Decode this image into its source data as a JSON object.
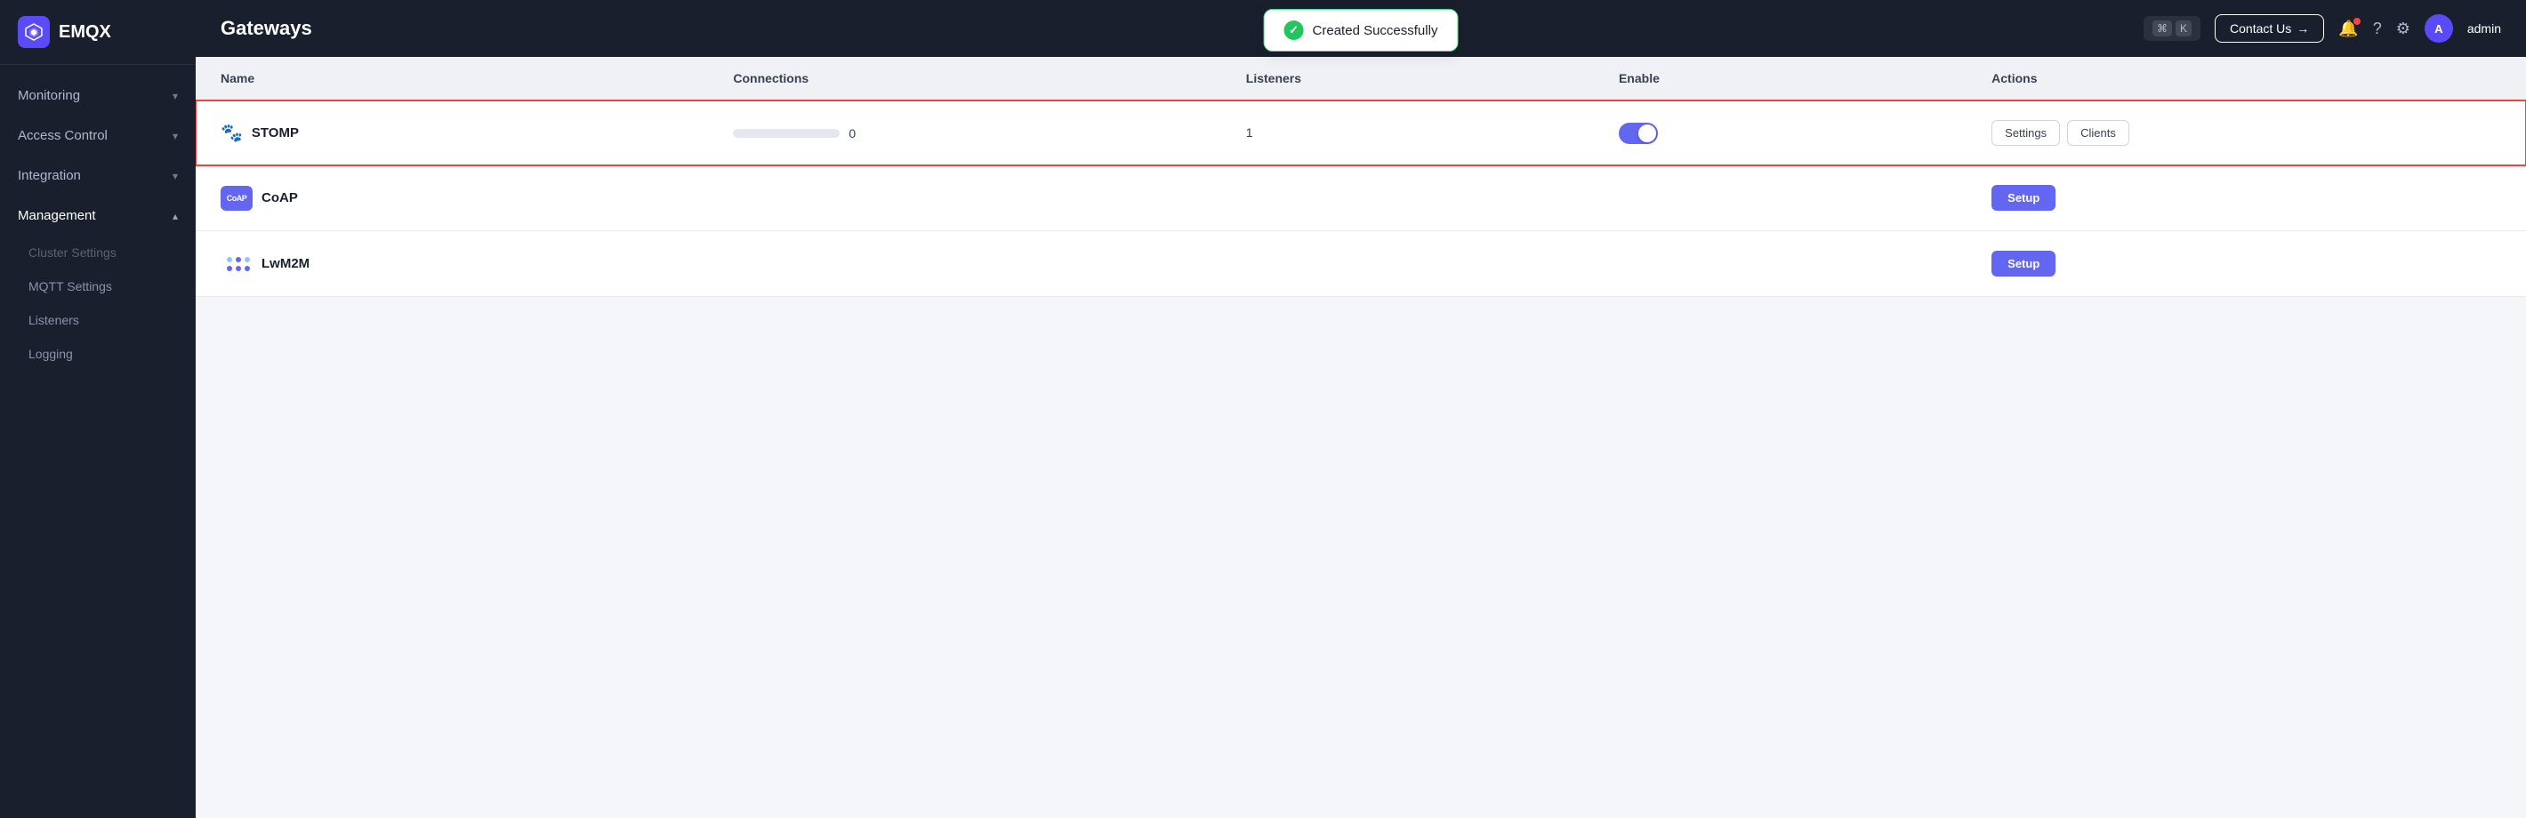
{
  "sidebar": {
    "logo": "EMQX",
    "nav": [
      {
        "id": "monitoring",
        "label": "Monitoring",
        "hasChevron": true,
        "expanded": false
      },
      {
        "id": "access-control",
        "label": "Access Control",
        "hasChevron": true,
        "expanded": false
      },
      {
        "id": "integration",
        "label": "Integration",
        "hasChevron": true,
        "expanded": false
      },
      {
        "id": "management",
        "label": "Management",
        "hasChevron": true,
        "expanded": true
      }
    ],
    "subItems": [
      {
        "id": "cluster-settings",
        "label": "Cluster Settings",
        "muted": true
      },
      {
        "id": "mqtt-settings",
        "label": "MQTT Settings",
        "muted": false
      },
      {
        "id": "listeners",
        "label": "Listeners",
        "muted": false
      },
      {
        "id": "logging",
        "label": "Logging",
        "muted": false
      }
    ]
  },
  "topbar": {
    "title": "Gateways",
    "kbd_mod": "⌘",
    "kbd_key": "K",
    "contact_label": "Contact Us",
    "contact_arrow": "→",
    "admin_label": "admin",
    "admin_initial": "A"
  },
  "toast": {
    "message": "Created Successfully"
  },
  "table": {
    "headers": [
      "Name",
      "Connections",
      "Listeners",
      "Enable",
      "Actions"
    ],
    "rows": [
      {
        "id": "stomp",
        "name": "STOMP",
        "icon_type": "stomp",
        "icon_label": "🐾",
        "connections": 0,
        "listeners": 1,
        "enabled": true,
        "highlighted": true,
        "actions": [
          "Settings",
          "Clients"
        ],
        "setup": null
      },
      {
        "id": "coap",
        "name": "CoAP",
        "icon_type": "coap",
        "icon_label": "CoAP",
        "connections": null,
        "listeners": null,
        "enabled": false,
        "highlighted": false,
        "actions": [],
        "setup": "Setup"
      },
      {
        "id": "lwm2m",
        "name": "LwM2M",
        "icon_type": "lwm2m",
        "icon_label": "⁛",
        "connections": null,
        "listeners": null,
        "enabled": false,
        "highlighted": false,
        "actions": [],
        "setup": "Setup"
      }
    ]
  },
  "colors": {
    "accent": "#6366f1",
    "danger": "#ef4444",
    "success": "#22c55e"
  }
}
